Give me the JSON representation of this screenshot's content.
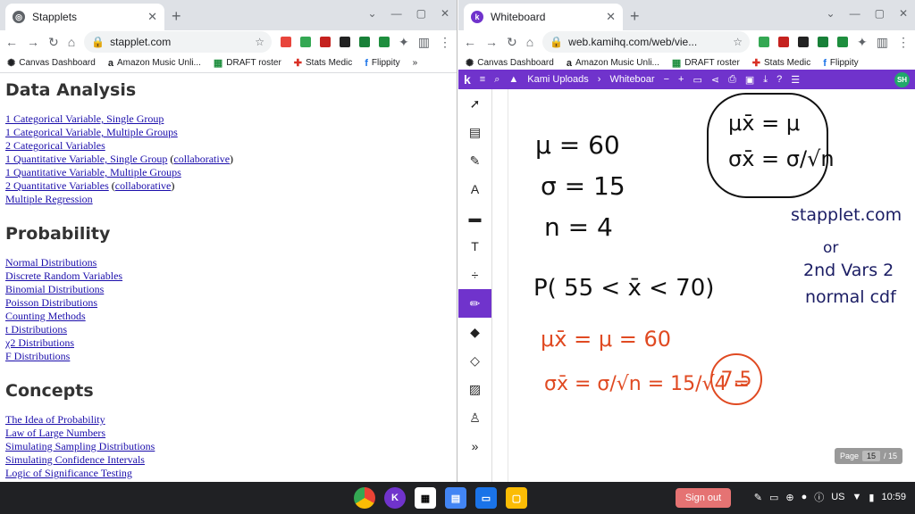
{
  "left_window": {
    "tab_title": "Stapplets",
    "url": "stapplet.com",
    "bookmarks": [
      "Canvas Dashboard",
      "Amazon Music Unli...",
      "DRAFT roster",
      "Stats Medic",
      "Flippity"
    ],
    "sections": [
      {
        "heading": "Data Analysis",
        "items": [
          "1 Categorical Variable, Single Group",
          "1 Categorical Variable, Multiple Groups",
          "2 Categorical Variables",
          "1 Quantitative Variable, Single Group",
          "1 Quantitative Variable, Multiple Groups",
          "2 Quantitative Variables",
          "Multiple Regression"
        ],
        "collab": "collaborative"
      },
      {
        "heading": "Probability",
        "items": [
          "Normal Distributions",
          "Discrete Random Variables",
          "Binomial Distributions",
          "Poisson Distributions",
          "Counting Methods",
          "t Distributions",
          "χ2 Distributions",
          "F Distributions"
        ]
      },
      {
        "heading": "Concepts",
        "items": [
          "The Idea of Probability",
          "Law of Large Numbers",
          "Simulating Sampling Distributions",
          "Simulating Confidence Intervals",
          "Logic of Significance Testing"
        ]
      }
    ]
  },
  "right_window": {
    "tab_title": "Whiteboard",
    "url": "web.kamihq.com/web/vie...",
    "bookmarks": [
      "Canvas Dashboard",
      "Amazon Music Unli...",
      "DRAFT roster",
      "Stats Medic",
      "Flippity"
    ],
    "kami_bar": {
      "uploads": "Kami Uploads",
      "doc": "Whiteboar",
      "avatar": "SH"
    },
    "page_label": "Page",
    "page_num": "15",
    "page_total": "/ 15",
    "notes": {
      "mu": "μ = 60",
      "sigma": "σ = 15",
      "n": "n = 4",
      "prob": "P( 55 < x̄ < 70)",
      "mu_xbar": "μx̄ = μ = 60",
      "sigma_xbar": "σx̄ = σ/√n = 15/√4 =",
      "answer": "7.5",
      "box_line1": "μx̄ = μ",
      "box_line2": "σx̄ = σ/√n",
      "side1": "stapplet.com",
      "side2": "or",
      "side3": "2nd Vars 2",
      "side4": "normal cdf"
    }
  },
  "taskbar": {
    "signout": "Sign out",
    "locale": "US",
    "time": "10:59"
  },
  "colors": {
    "kami_purple": "#7033cc",
    "red_ink": "#e04a22",
    "blue_ink": "#1b1d64"
  }
}
